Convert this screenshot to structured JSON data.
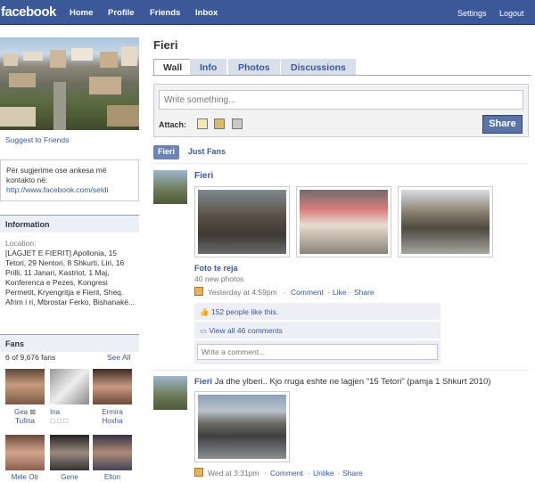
{
  "topbar": {
    "logo": "facebook",
    "nav": [
      "Home",
      "Profile",
      "Friends",
      "Inbox"
    ],
    "right": [
      "Settings",
      "Logout"
    ]
  },
  "left": {
    "suggest": "Suggest to Friends",
    "contact_text": "Për sugjerime ose ankesa më kontakto në:",
    "contact_link": "http://www.facebook.com/seldi",
    "information_title": "Information",
    "location_label": "Location:",
    "location_value": "[LAGJET E FIERIT] Apollonia, 15 Tetori, 29 Nentori, 8 Shkurti, Liri, 16 Prilli, 11 Janari, Kastriot, 1 Maj, Konferenca e Pezes, Kongresi Permetit, Kryengritja e Fierit, Sheq. Afrim i ri, Mbrostar Ferko, Bishanakë...",
    "fans_title": "Fans",
    "fans_count": "6 of 9,676 fans",
    "see_all": "See All",
    "fans": [
      {
        "name": "Gea",
        "name2": "Tufina"
      },
      {
        "name": "Ina",
        "name2": ""
      },
      {
        "name": "Ermira",
        "name2": "Hoxha"
      },
      {
        "name": "Mele Otr",
        "name2": ""
      },
      {
        "name": "Gene",
        "name2": ""
      },
      {
        "name": "Elton",
        "name2": ""
      }
    ]
  },
  "page": {
    "name": "Fieri",
    "tabs": [
      "Wall",
      "Info",
      "Photos",
      "Discussions"
    ],
    "publisher_placeholder": "Write something...",
    "attach_label": "Attach:",
    "share_label": "Share",
    "filter_active": "Fieri",
    "filter_other": "Just Fans"
  },
  "post1": {
    "author": "Fieri",
    "album_title": "Foto te reja",
    "album_sub": "40 new photos",
    "time": "Yesterday at 4:59pm",
    "actions": [
      "Comment",
      "Like",
      "Share"
    ],
    "likes": "152 people like this.",
    "view_comments": "View all 46 comments",
    "comment_placeholder": "Write a comment..."
  },
  "post2": {
    "author": "Fieri",
    "text": "Ja dhe ylberi.. Kjo rruga eshte ne lagjen \"15 Tetori\" (pamja 1 Shkurt 2010)",
    "time": "Wed at 3:31pm",
    "actions": [
      "Comment",
      "Unlike",
      "Share"
    ]
  }
}
